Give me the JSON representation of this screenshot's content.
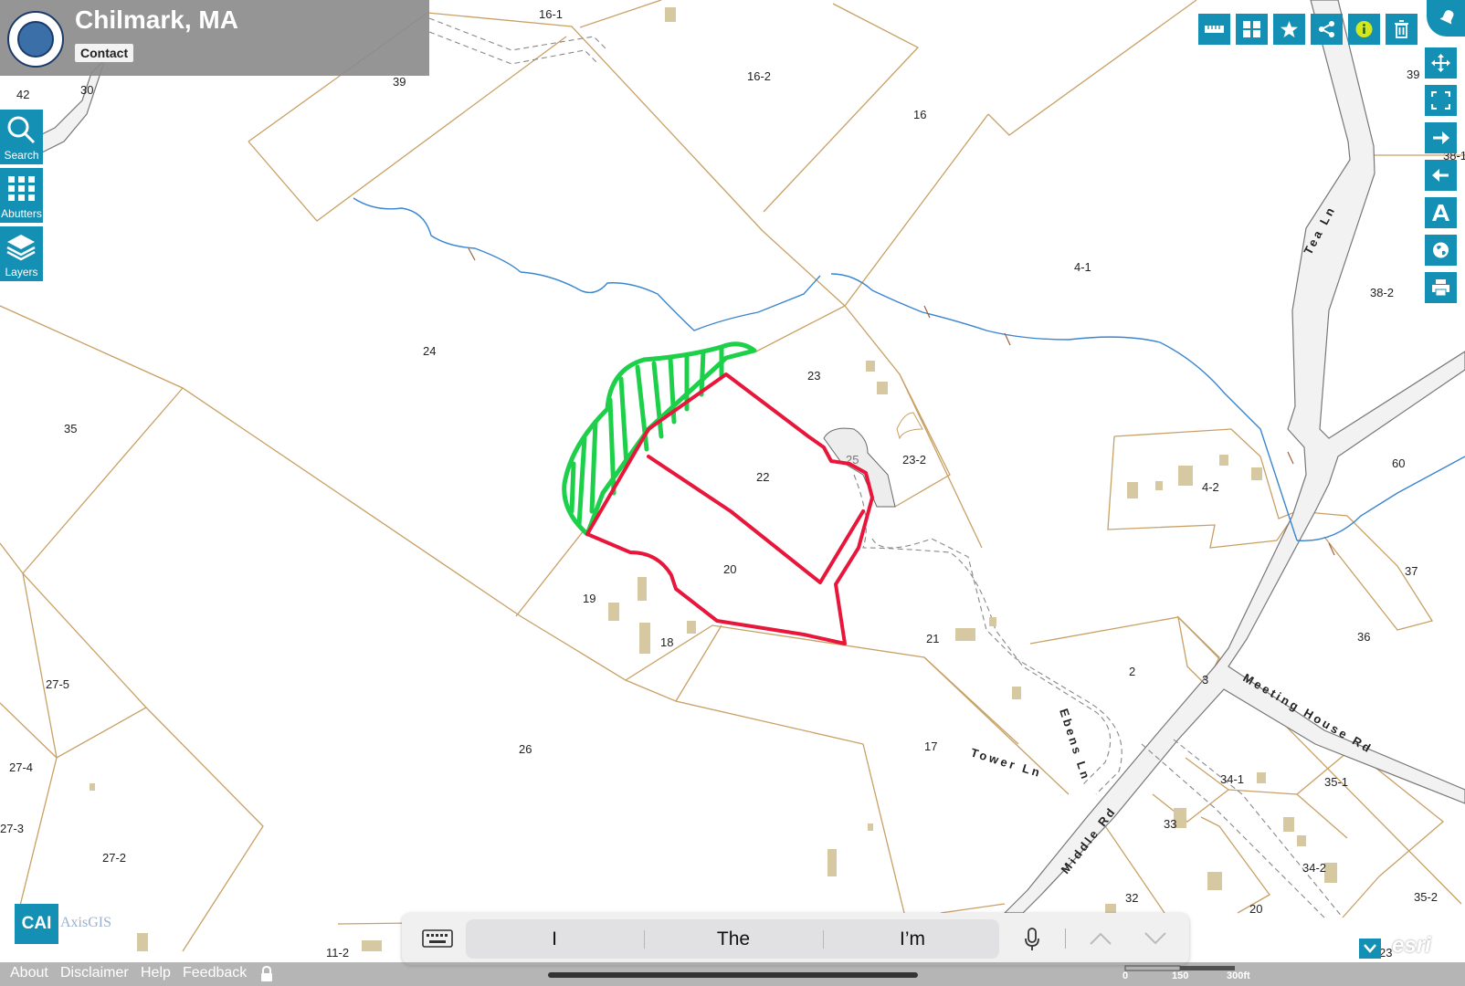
{
  "header": {
    "title": "Chilmark, MA",
    "contact_label": "Contact",
    "seal_text": "CHILMARK MASS"
  },
  "left_toolbar": [
    {
      "label": "Search",
      "icon": "search-icon"
    },
    {
      "label": "Abutters",
      "icon": "abutters-icon"
    },
    {
      "label": "Layers",
      "icon": "layers-icon"
    }
  ],
  "top_toolbar": [
    {
      "name": "measure",
      "icon": "ruler-icon"
    },
    {
      "name": "basemaps",
      "icon": "grid-icon"
    },
    {
      "name": "bookmarks",
      "icon": "star-icon"
    },
    {
      "name": "share",
      "icon": "share-icon"
    },
    {
      "name": "identify",
      "icon": "info-icon"
    },
    {
      "name": "clear",
      "icon": "trash-icon"
    }
  ],
  "right_toolbar": [
    {
      "name": "pan",
      "icon": "move-icon"
    },
    {
      "name": "full-extent",
      "icon": "expand-icon"
    },
    {
      "name": "next-extent",
      "icon": "arrow-right-icon"
    },
    {
      "name": "previous-extent",
      "icon": "arrow-left-icon"
    },
    {
      "name": "labels",
      "icon": "text-icon"
    },
    {
      "name": "globe",
      "icon": "globe-icon"
    },
    {
      "name": "print",
      "icon": "print-icon"
    }
  ],
  "parcels": [
    {
      "id": "p16-1",
      "label": "16-1"
    },
    {
      "id": "p16-2",
      "label": "16-2"
    },
    {
      "id": "p16",
      "label": "16"
    },
    {
      "id": "p39a",
      "label": "39"
    },
    {
      "id": "p39b",
      "label": "39"
    },
    {
      "id": "p42",
      "label": "42"
    },
    {
      "id": "p30",
      "label": "30"
    },
    {
      "id": "p24",
      "label": "24"
    },
    {
      "id": "p4-1",
      "label": "4-1"
    },
    {
      "id": "p38-2",
      "label": "38-2"
    },
    {
      "id": "p38-1",
      "label": "38-1"
    },
    {
      "id": "p23",
      "label": "23"
    },
    {
      "id": "p22",
      "label": "22"
    },
    {
      "id": "p25",
      "label": "25"
    },
    {
      "id": "p23-2",
      "label": "23-2"
    },
    {
      "id": "p35",
      "label": "35"
    },
    {
      "id": "p4-2",
      "label": "4-2"
    },
    {
      "id": "p60",
      "label": "60"
    },
    {
      "id": "p20",
      "label": "20"
    },
    {
      "id": "p19",
      "label": "19"
    },
    {
      "id": "p18",
      "label": "18"
    },
    {
      "id": "p21",
      "label": "21"
    },
    {
      "id": "p37",
      "label": "37"
    },
    {
      "id": "p36",
      "label": "36"
    },
    {
      "id": "p2",
      "label": "2"
    },
    {
      "id": "p3",
      "label": "3"
    },
    {
      "id": "p27-5",
      "label": "27-5"
    },
    {
      "id": "p26",
      "label": "26"
    },
    {
      "id": "p17",
      "label": "17"
    },
    {
      "id": "p27-4",
      "label": "27-4"
    },
    {
      "id": "p34-1",
      "label": "34-1"
    },
    {
      "id": "p35-1",
      "label": "35-1"
    },
    {
      "id": "p27-3",
      "label": "27-3"
    },
    {
      "id": "p27-2",
      "label": "27-2"
    },
    {
      "id": "p33",
      "label": "33"
    },
    {
      "id": "p34-2",
      "label": "34-2"
    },
    {
      "id": "p35-2",
      "label": "35-2"
    },
    {
      "id": "p32",
      "label": "32"
    },
    {
      "id": "p20b",
      "label": "20"
    },
    {
      "id": "p23b",
      "label": "23"
    },
    {
      "id": "p11-2",
      "label": "11-2"
    }
  ],
  "roads": [
    {
      "id": "tea-ln",
      "label": "Tea Ln"
    },
    {
      "id": "meeting-house-rd",
      "label": "Meeting House Rd"
    },
    {
      "id": "ebens-ln",
      "label": "Ebens Ln"
    },
    {
      "id": "tower-ln",
      "label": "Tower Ln"
    },
    {
      "id": "middle-rd",
      "label": "Middle Rd"
    }
  ],
  "keyboard_suggestions": [
    "I",
    "The",
    "I’m"
  ],
  "footer": {
    "links": [
      "About",
      "Disclaimer",
      "Help",
      "Feedback"
    ],
    "scale_labels": [
      "0",
      "150",
      "300ft"
    ],
    "cai_label": "CAI",
    "axisgis_label": "AxisGIS",
    "esri_label": "esri"
  },
  "colors": {
    "toolbar": "#1590b5",
    "parcel_line": "#c8a064",
    "stream": "#3a85d0",
    "red_markup": "#e8163a",
    "green_markup": "#1dd04a",
    "building": "#d6c8a0"
  }
}
